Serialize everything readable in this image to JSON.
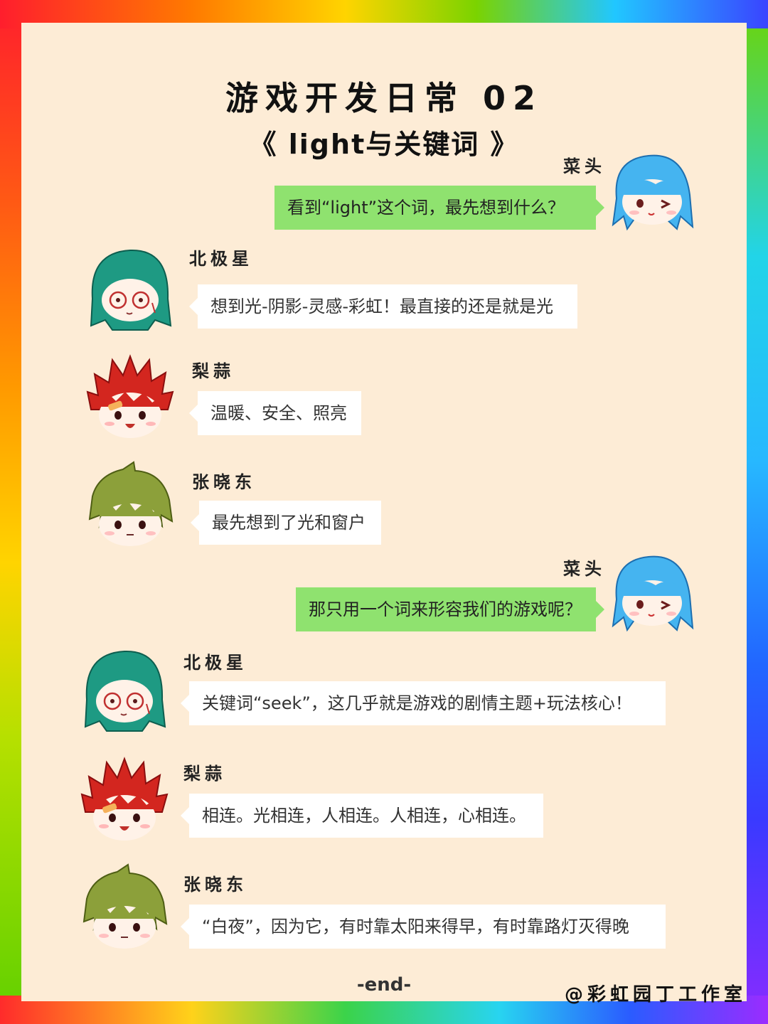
{
  "header": {
    "title": "游戏开发日常 02",
    "subtitle": "《 light与关键词 》"
  },
  "messages": [
    {
      "speaker": "菜头",
      "text": "看到“light”这个词，最先想到什么？"
    },
    {
      "speaker": "北极星",
      "text": "想到光-阴影-灵感-彩虹！最直接的还是就是光"
    },
    {
      "speaker": "梨蒜",
      "text": "温暖、安全、照亮"
    },
    {
      "speaker": "张晓东",
      "text": "最先想到了光和窗户"
    },
    {
      "speaker": "菜头",
      "text": "那只用一个词来形容我们的游戏呢？"
    },
    {
      "speaker": "北极星",
      "text": "关键词“seek”，这几乎就是游戏的剧情主题+玩法核心！"
    },
    {
      "speaker": "梨蒜",
      "text": "相连。光相连，人相连。人相连，心相连。"
    },
    {
      "speaker": "张晓东",
      "text": "“白夜”，因为它，有时靠太阳来得早，有时靠路灯灭得晚"
    }
  ],
  "footer": {
    "end": "-end-",
    "credit": "@彩虹园丁工作室"
  },
  "colors": {
    "paper": "#fdecd6",
    "bubble_green": "#8fe26f",
    "bubble_white": "#ffffff"
  },
  "icons": [
    "avatar-caitou-blue-hair",
    "avatar-beijixing-green-hair",
    "avatar-lisuan-red-hair",
    "avatar-zhangxiaodong-olive-hair"
  ]
}
